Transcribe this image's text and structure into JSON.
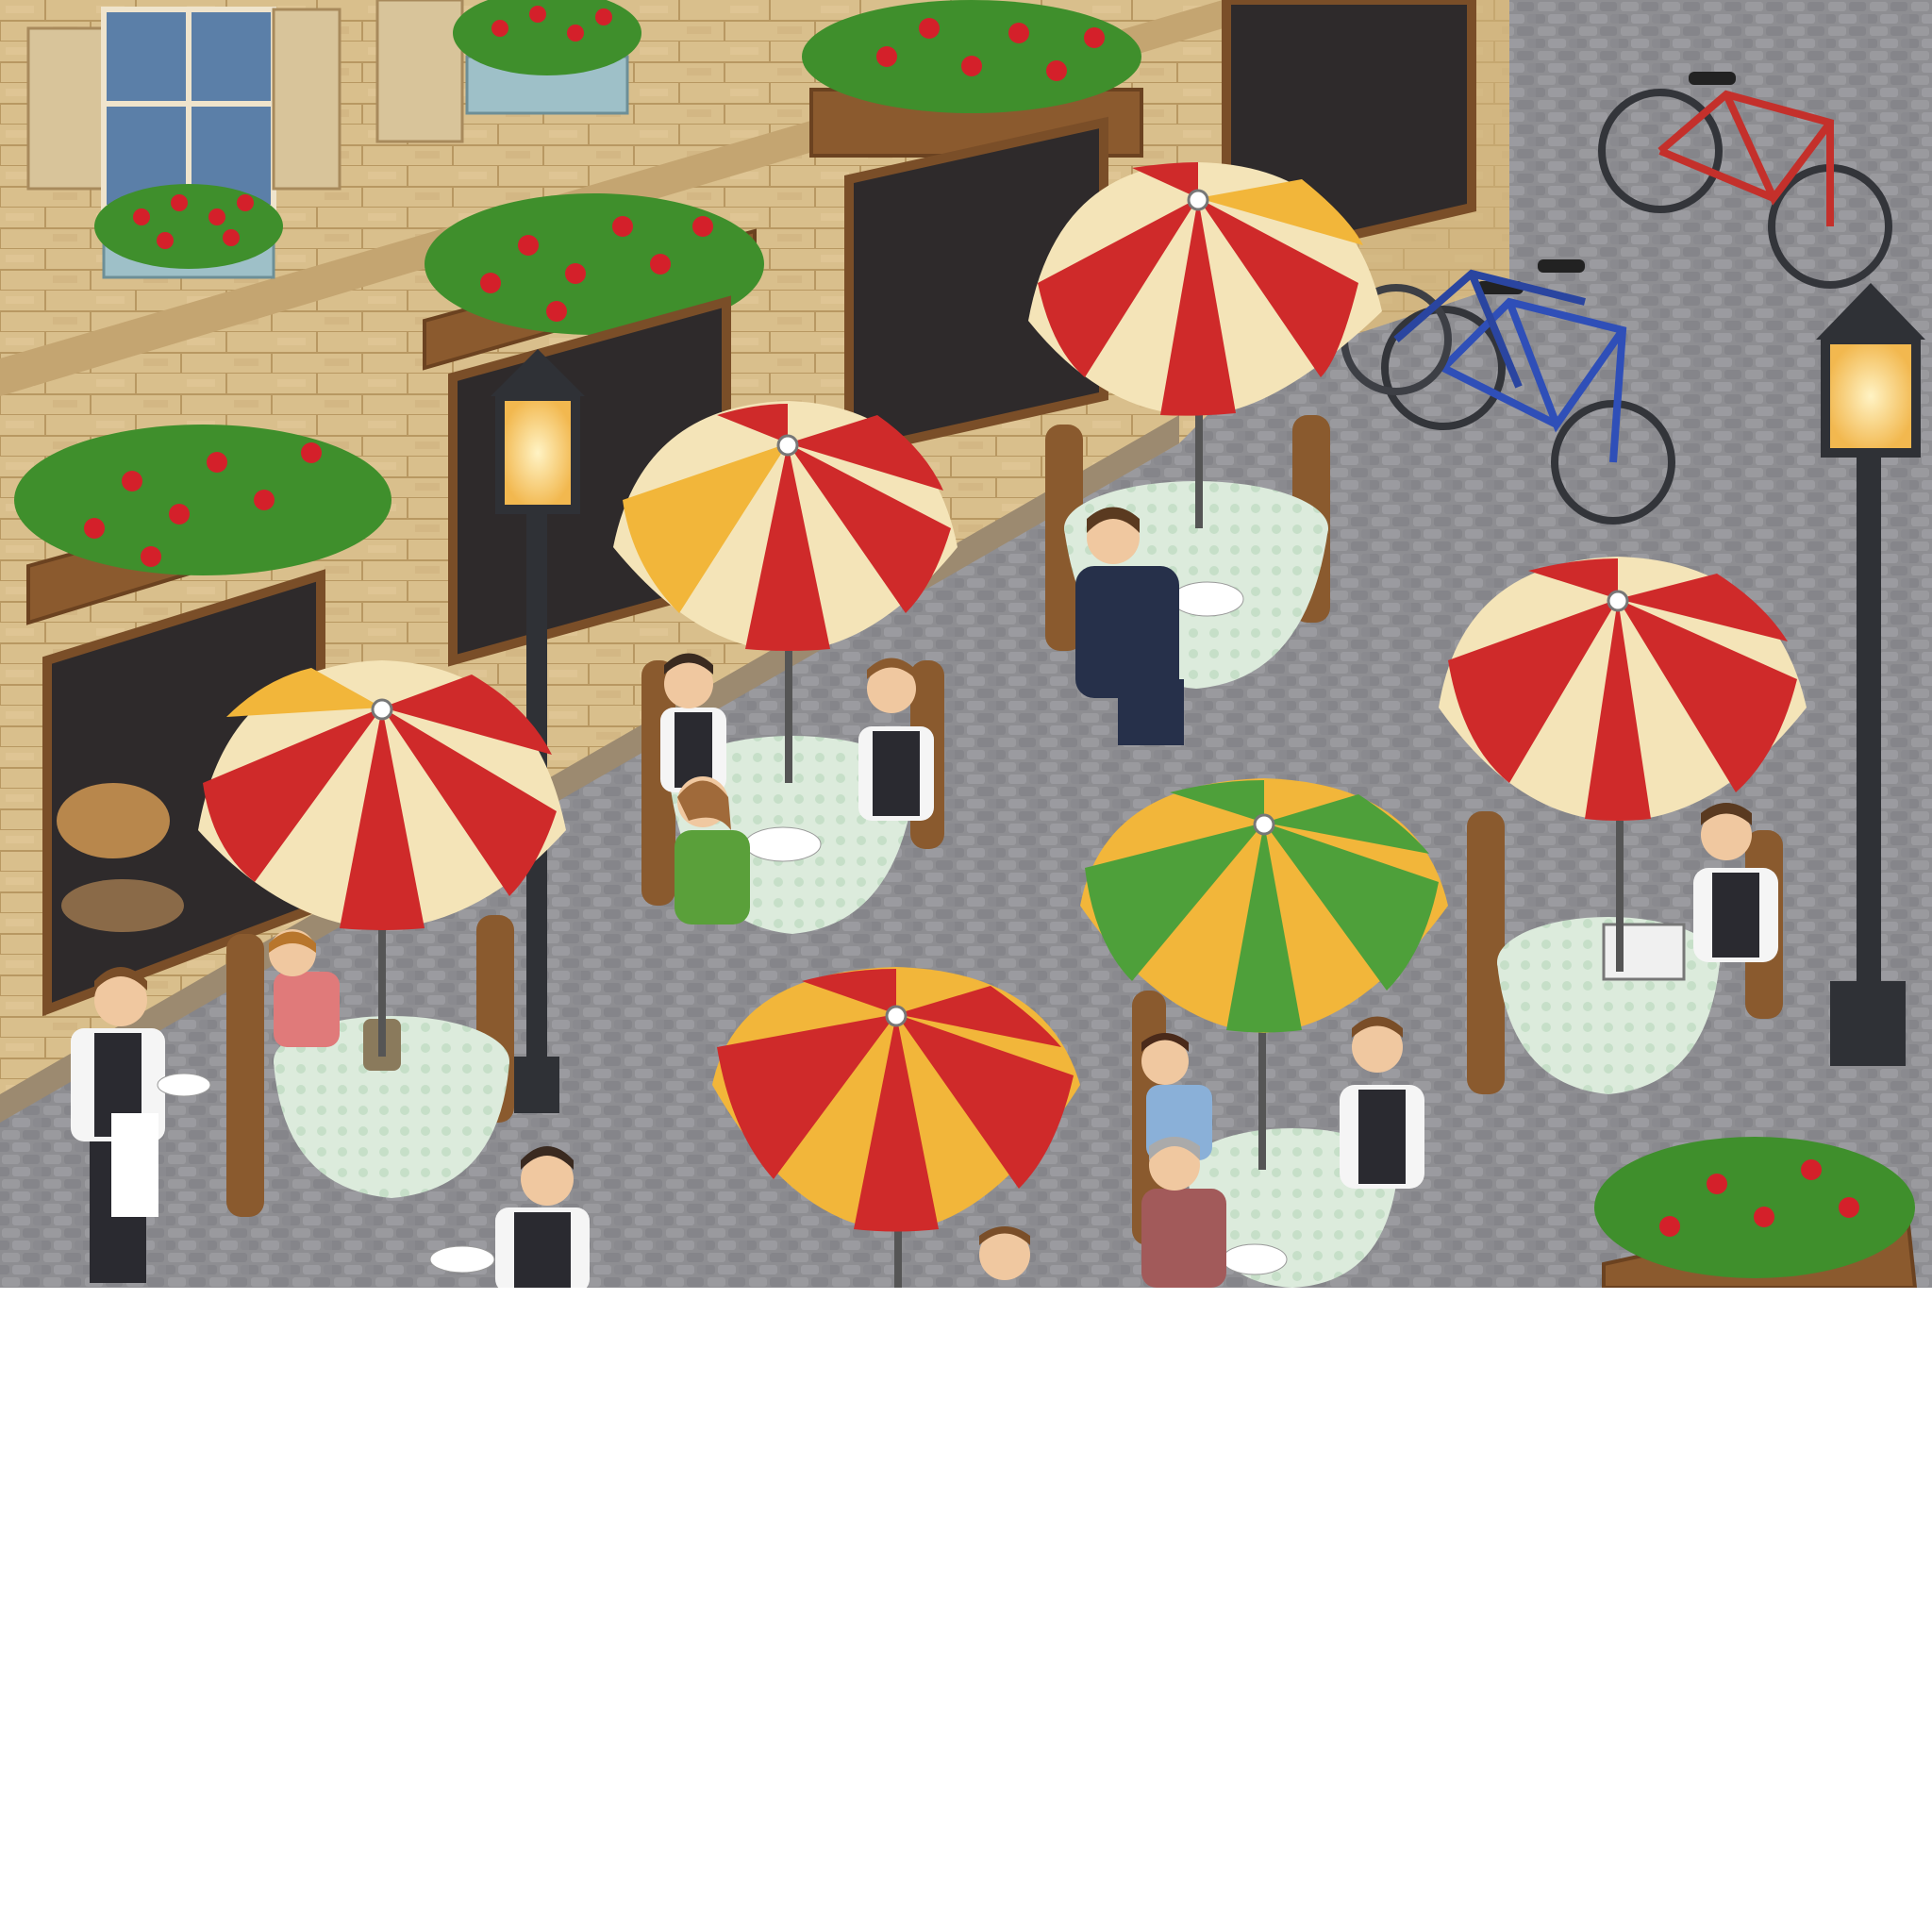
{
  "scene": {
    "kind": "isometric pixel-art cafe terrace",
    "colors": {
      "wall": "#d9bf8c",
      "wall_shade": "#c4a571",
      "wall_line": "#b89862",
      "trim": "#9a6a3c",
      "shutter": "#d8c49a",
      "window_glass": "#5b7fa8",
      "shop_window": "#2e2a2b",
      "flower_leaf": "#3f8f2c",
      "flower_red": "#d4202a",
      "cobble": "#8e8e92",
      "cobble_dark": "#6f6f74",
      "lamp_metal": "#2f3136",
      "lamp_glow": "#ffd98a",
      "tablecloth": "#dcebdc",
      "chair_wood": "#8a5a2e",
      "umbrella_red": "#cf2a2a",
      "umbrella_cream": "#f4e4b8",
      "umbrella_yellow": "#f2b63a",
      "umbrella_green": "#4ea03a",
      "bike_red": "#c4302b",
      "bike_blue": "#2f4fb8",
      "waiter_vest": "#2a2a30",
      "waiter_shirt": "#f5f5f5",
      "blank_area": "#ffffff"
    },
    "umbrellas": [
      {
        "id": "far-right-umbrella",
        "pattern": [
          "red",
          "cream",
          "red",
          "yellow"
        ]
      },
      {
        "id": "middle-left-umbrella",
        "pattern": [
          "red",
          "cream",
          "yellow",
          "cream"
        ]
      },
      {
        "id": "front-left-umbrella",
        "pattern": [
          "red",
          "cream",
          "yellow",
          "cream"
        ]
      },
      {
        "id": "right-umbrella",
        "pattern": [
          "red",
          "cream"
        ]
      },
      {
        "id": "green-umbrella",
        "pattern": [
          "green",
          "yellow"
        ]
      },
      {
        "id": "front-center-umbrella",
        "pattern": [
          "red",
          "yellow"
        ]
      }
    ],
    "bicycles": [
      {
        "id": "red-bicycle",
        "color": "red"
      },
      {
        "id": "blue-bicycle",
        "color": "blue"
      },
      {
        "id": "blue-bicycle-2",
        "color": "blue"
      }
    ],
    "people_count": 13,
    "table_count": 6,
    "lamp_count": 2
  }
}
